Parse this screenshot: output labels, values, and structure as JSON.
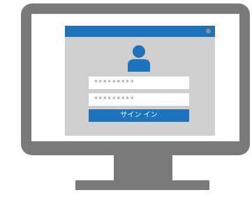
{
  "login": {
    "username_field": "*********",
    "password_field": "*********",
    "signin_label": "サイン イン"
  },
  "colors": {
    "accent": "#1e73be",
    "monitor": "#7a7a7a",
    "window_bg": "#cfcfcf"
  },
  "icons": {
    "user": "user-icon",
    "window_dot": "window-status-dot-icon"
  }
}
